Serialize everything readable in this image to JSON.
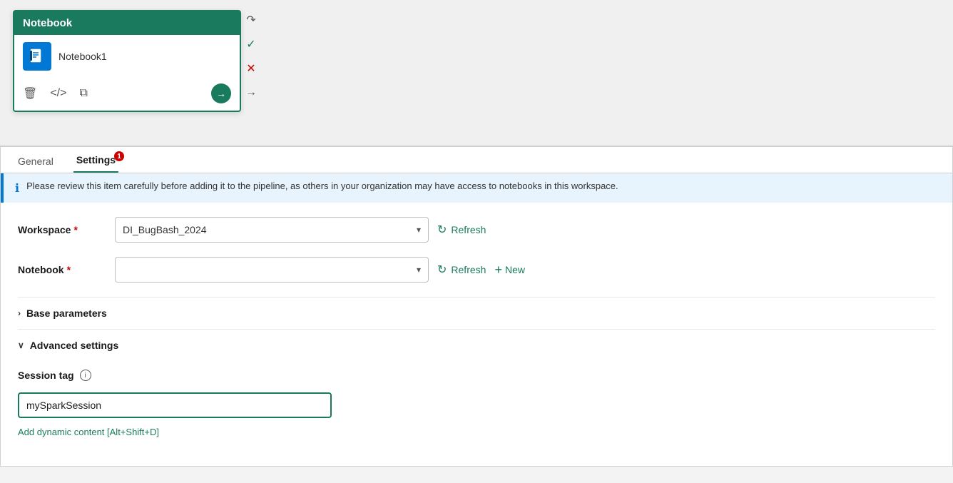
{
  "notebook_card": {
    "title": "Notebook",
    "name": "Notebook1"
  },
  "side_actions": {
    "redo": "↷",
    "check": "✓",
    "close": "✕",
    "arrow": "→"
  },
  "tabs": [
    {
      "id": "general",
      "label": "General",
      "active": false,
      "badge": null
    },
    {
      "id": "settings",
      "label": "Settings",
      "active": true,
      "badge": "1"
    }
  ],
  "info_banner": {
    "text": "Please review this item carefully before adding it to the pipeline, as others in your organization may have access to notebooks in this workspace."
  },
  "workspace_field": {
    "label": "Workspace",
    "required": true,
    "value": "DI_BugBash_2024",
    "refresh_label": "Refresh"
  },
  "notebook_field": {
    "label": "Notebook",
    "required": true,
    "value": "",
    "refresh_label": "Refresh",
    "new_label": "New"
  },
  "base_parameters": {
    "label": "Base parameters",
    "expanded": false
  },
  "advanced_settings": {
    "label": "Advanced settings",
    "expanded": true
  },
  "session_tag": {
    "label": "Session tag",
    "value": "mySparkSession",
    "dynamic_content_label": "Add dynamic content [Alt+Shift+D]"
  }
}
